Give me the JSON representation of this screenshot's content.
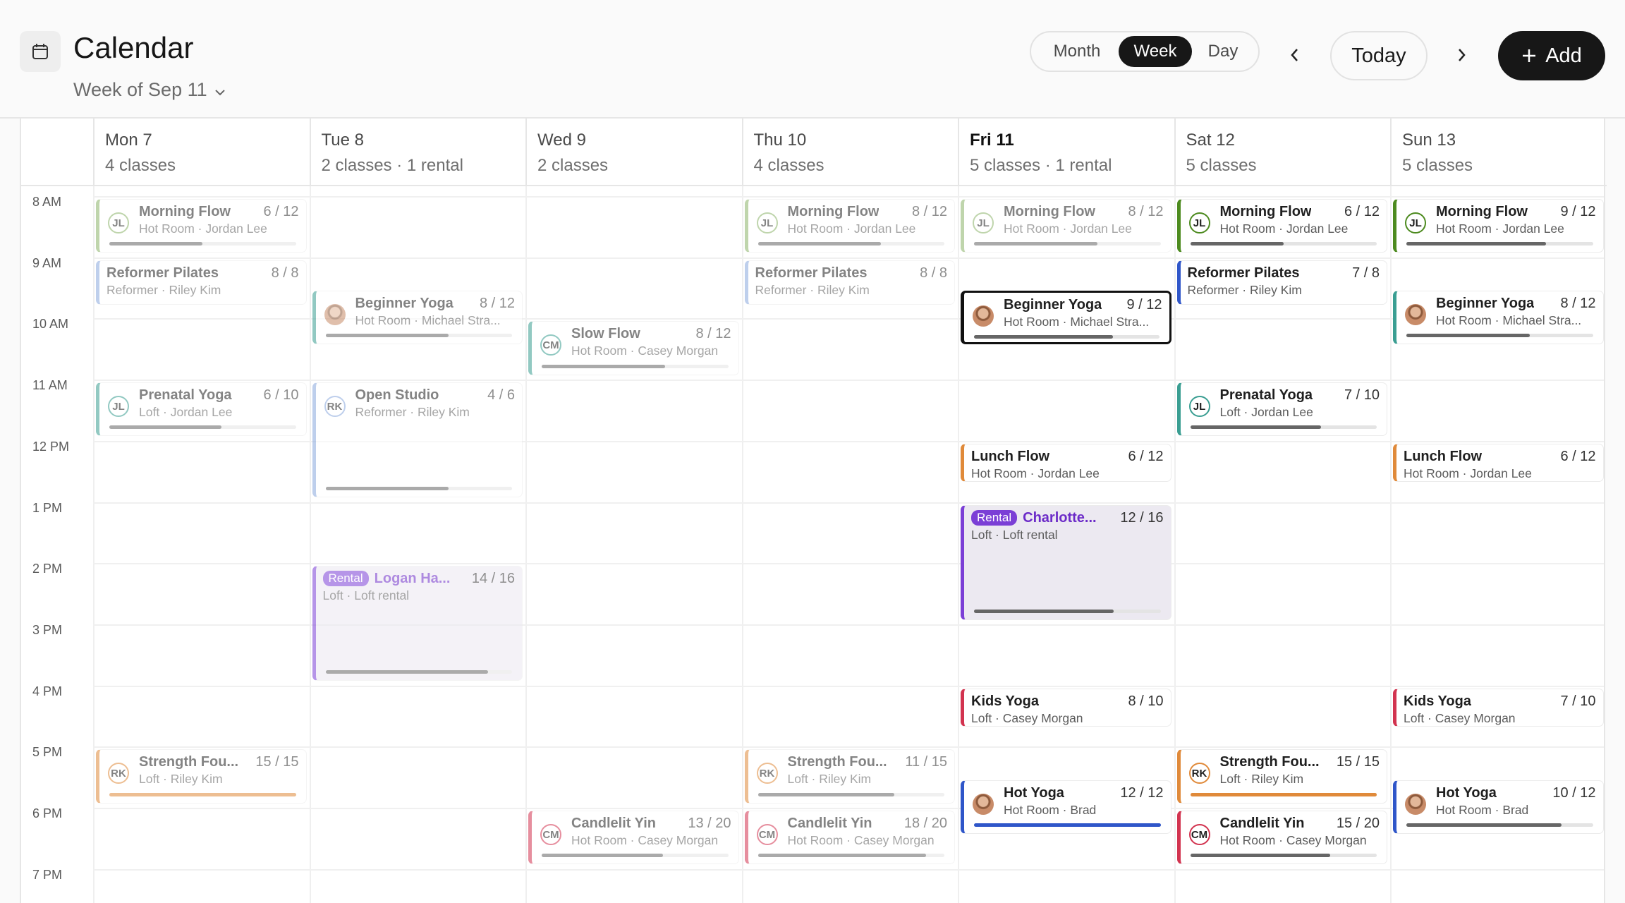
{
  "header": {
    "title": "Calendar",
    "week_label": "Week of Sep 11",
    "views": [
      "Month",
      "Week",
      "Day"
    ],
    "active_view": "Week",
    "today_label": "Today",
    "add_label": "Add"
  },
  "colors": {
    "green": "#8bb46a",
    "dark_green": "#4c8a1e",
    "blue": "#8aa8dd",
    "teal": "#3a9e92",
    "orange": "#e08a3a",
    "purple": "#7b3fd6",
    "red": "#d2334f",
    "navy": "#2f56c9"
  },
  "time_labels": [
    "8 AM",
    "9 AM",
    "10 AM",
    "11 AM",
    "12 PM",
    "1 PM",
    "2 PM",
    "3 PM",
    "4 PM",
    "5 PM",
    "6 PM",
    "7 PM"
  ],
  "days": [
    {
      "name": "Mon 7",
      "count": "4 classes",
      "today": false
    },
    {
      "name": "Tue 8",
      "count": "2 classes · 1 rental",
      "today": false
    },
    {
      "name": "Wed 9",
      "count": "2 classes",
      "today": false
    },
    {
      "name": "Thu 10",
      "count": "4 classes",
      "today": false
    },
    {
      "name": "Fri 11",
      "count": "5 classes · 1 rental",
      "today": true
    },
    {
      "name": "Sat 12",
      "count": "5 classes",
      "today": false
    },
    {
      "name": "Sun 13",
      "count": "5 classes",
      "today": false
    }
  ],
  "events": [
    {
      "day": 0,
      "start": 8.2,
      "dur": 0.95,
      "title": "Morning Flow",
      "sub": "Hot Room · Jordan Lee",
      "cap": "6 / 12",
      "fill": 0.5,
      "color": "green",
      "avatar": "JL",
      "dim": true
    },
    {
      "day": 0,
      "start": 9.2,
      "dur": 0.8,
      "title": "Reformer Pilates",
      "sub": "Reformer · Riley Kim",
      "cap": "8 / 8",
      "fill": null,
      "color": "blue",
      "avatar": null,
      "dim": true
    },
    {
      "day": 0,
      "start": 11.2,
      "dur": 0.95,
      "title": "Prenatal Yoga",
      "sub": "Loft · Jordan Lee",
      "cap": "6 / 10",
      "fill": 0.6,
      "color": "teal",
      "avatar": "JL",
      "dim": true
    },
    {
      "day": 0,
      "start": 17.2,
      "dur": 0.95,
      "title": "Strength Fou...",
      "sub": "Loft · Riley Kim",
      "cap": "15 / 15",
      "fill": 1.0,
      "color": "orange",
      "avatar": "RK",
      "dim": true
    },
    {
      "day": 1,
      "start": 9.7,
      "dur": 0.95,
      "title": "Beginner Yoga",
      "sub": "Hot Room · Michael Stra...",
      "cap": "8 / 12",
      "fill": 0.66,
      "color": "teal",
      "avatar": "photo",
      "dim": true
    },
    {
      "day": 1,
      "start": 11.2,
      "dur": 1.95,
      "title": "Open Studio",
      "sub": "Reformer · Riley Kim",
      "cap": "4 / 6",
      "fill": 0.66,
      "color": "blue",
      "avatar": "RK",
      "dim": true
    },
    {
      "day": 1,
      "start": 14.2,
      "dur": 1.95,
      "title": "Logan Ha...",
      "sub": "Loft · Loft rental",
      "cap": "14 / 16",
      "fill": 0.87,
      "color": "purple",
      "avatar": null,
      "rental": true,
      "dim": true
    },
    {
      "day": 2,
      "start": 10.2,
      "dur": 0.95,
      "title": "Slow Flow",
      "sub": "Hot Room · Casey Morgan",
      "cap": "8 / 12",
      "fill": 0.66,
      "color": "teal",
      "avatar": "CM",
      "dim": true
    },
    {
      "day": 2,
      "start": 18.2,
      "dur": 0.95,
      "title": "Candlelit Yin",
      "sub": "Hot Room · Casey Morgan",
      "cap": "13 / 20",
      "fill": 0.65,
      "color": "red",
      "avatar": "CM",
      "dim": true
    },
    {
      "day": 3,
      "start": 8.2,
      "dur": 0.95,
      "title": "Morning Flow",
      "sub": "Hot Room · Jordan Lee",
      "cap": "8 / 12",
      "fill": 0.66,
      "color": "green",
      "avatar": "JL",
      "dim": true
    },
    {
      "day": 3,
      "start": 9.2,
      "dur": 0.8,
      "title": "Reformer Pilates",
      "sub": "Reformer · Riley Kim",
      "cap": "8 / 8",
      "fill": null,
      "color": "blue",
      "avatar": null,
      "dim": true
    },
    {
      "day": 3,
      "start": 17.2,
      "dur": 0.95,
      "title": "Strength Fou...",
      "sub": "Loft · Riley Kim",
      "cap": "11 / 15",
      "fill": 0.73,
      "color": "orange",
      "avatar": "RK",
      "dim": true
    },
    {
      "day": 3,
      "start": 18.2,
      "dur": 0.95,
      "title": "Candlelit Yin",
      "sub": "Hot Room · Casey Morgan",
      "cap": "18 / 20",
      "fill": 0.9,
      "color": "red",
      "avatar": "CM",
      "dim": true
    },
    {
      "day": 4,
      "start": 8.2,
      "dur": 0.95,
      "title": "Morning Flow",
      "sub": "Hot Room · Jordan Lee",
      "cap": "8 / 12",
      "fill": 0.66,
      "color": "green",
      "avatar": "JL",
      "dim": true
    },
    {
      "day": 4,
      "start": 9.7,
      "dur": 0.95,
      "title": "Beginner Yoga",
      "sub": "Hot Room · Michael Stra...",
      "cap": "9 / 12",
      "fill": 0.75,
      "color": "teal",
      "avatar": "photo",
      "selected": true
    },
    {
      "day": 4,
      "start": 12.2,
      "dur": 0.7,
      "title": "Lunch Flow",
      "sub": "Hot Room · Jordan Lee",
      "cap": "6 / 12",
      "fill": null,
      "color": "orange",
      "avatar": null
    },
    {
      "day": 4,
      "start": 13.2,
      "dur": 1.95,
      "title": "Charlotte...",
      "sub": "Loft · Loft rental",
      "cap": "12 / 16",
      "fill": 0.75,
      "color": "purple",
      "avatar": null,
      "rental": true
    },
    {
      "day": 4,
      "start": 16.2,
      "dur": 0.7,
      "title": "Kids Yoga",
      "sub": "Loft · Casey Morgan",
      "cap": "8 / 10",
      "fill": null,
      "color": "red",
      "avatar": null
    },
    {
      "day": 4,
      "start": 17.7,
      "dur": 0.95,
      "title": "Hot Yoga",
      "sub": "Hot Room · Brad",
      "cap": "12 / 12",
      "fill": 1.0,
      "color": "navy",
      "avatar": "photo"
    },
    {
      "day": 5,
      "start": 8.2,
      "dur": 0.95,
      "title": "Morning Flow",
      "sub": "Hot Room · Jordan Lee",
      "cap": "6 / 12",
      "fill": 0.5,
      "color": "dark_green",
      "avatar": "JL"
    },
    {
      "day": 5,
      "start": 9.2,
      "dur": 0.8,
      "title": "Reformer Pilates",
      "sub": "Reformer · Riley Kim",
      "cap": "7 / 8",
      "fill": null,
      "color": "navy",
      "avatar": null
    },
    {
      "day": 5,
      "start": 11.2,
      "dur": 0.95,
      "title": "Prenatal Yoga",
      "sub": "Loft · Jordan Lee",
      "cap": "7 / 10",
      "fill": 0.7,
      "color": "teal",
      "avatar": "JL"
    },
    {
      "day": 5,
      "start": 17.2,
      "dur": 0.95,
      "title": "Strength Fou...",
      "sub": "Loft · Riley Kim",
      "cap": "15 / 15",
      "fill": 1.0,
      "color": "orange",
      "avatar": "RK"
    },
    {
      "day": 5,
      "start": 18.2,
      "dur": 0.95,
      "title": "Candlelit Yin",
      "sub": "Hot Room · Casey Morgan",
      "cap": "15 / 20",
      "fill": 0.75,
      "color": "red",
      "avatar": "CM"
    },
    {
      "day": 6,
      "start": 8.2,
      "dur": 0.95,
      "title": "Morning Flow",
      "sub": "Hot Room · Jordan Lee",
      "cap": "9 / 12",
      "fill": 0.75,
      "color": "dark_green",
      "avatar": "JL"
    },
    {
      "day": 6,
      "start": 9.7,
      "dur": 0.95,
      "title": "Beginner Yoga",
      "sub": "Hot Room · Michael Stra...",
      "cap": "8 / 12",
      "fill": 0.66,
      "color": "teal",
      "avatar": "photo"
    },
    {
      "day": 6,
      "start": 12.2,
      "dur": 0.7,
      "title": "Lunch Flow",
      "sub": "Hot Room · Jordan Lee",
      "cap": "6 / 12",
      "fill": null,
      "color": "orange",
      "avatar": null
    },
    {
      "day": 6,
      "start": 16.2,
      "dur": 0.7,
      "title": "Kids Yoga",
      "sub": "Loft · Casey Morgan",
      "cap": "7 / 10",
      "fill": null,
      "color": "red",
      "avatar": null
    },
    {
      "day": 6,
      "start": 17.7,
      "dur": 0.95,
      "title": "Hot Yoga",
      "sub": "Hot Room · Brad",
      "cap": "10 / 12",
      "fill": 0.83,
      "color": "navy",
      "avatar": "photo"
    }
  ],
  "rental_label": "Rental"
}
